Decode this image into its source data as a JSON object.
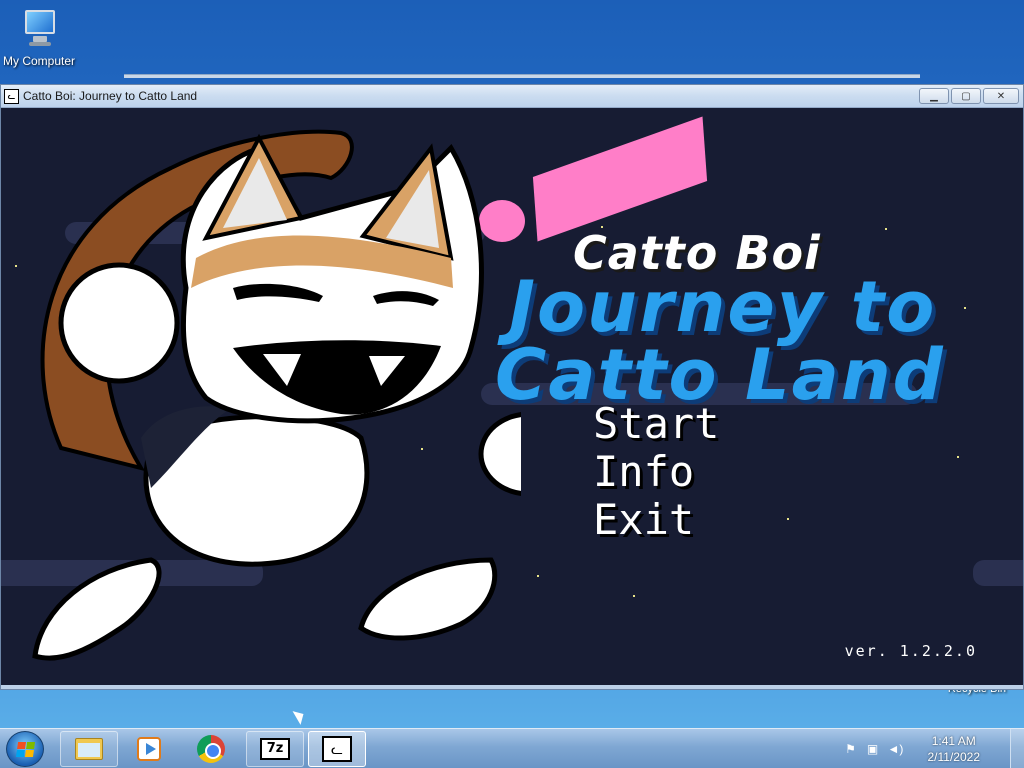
{
  "desktop": {
    "icons": [
      {
        "label": "My Computer",
        "icon": "my-computer-icon"
      }
    ],
    "recycle_bin_label": "Recycle Bin"
  },
  "window": {
    "title": "Catto Boi: Journey to Catto Land",
    "icon": "catto-app-icon",
    "controls": {
      "minimize": "▁",
      "maximize": "▢",
      "close": "✕"
    }
  },
  "game": {
    "logo": {
      "line1": "Catto Boi",
      "line2": "Journey to",
      "line3": "Catto Land"
    },
    "menu": [
      {
        "label": "Start"
      },
      {
        "label": "Info"
      },
      {
        "label": "Exit"
      }
    ],
    "version": "ver. 1.2.2.0",
    "colors": {
      "background": "#171c33",
      "logo_blue": "#2aa0ee",
      "accent_pink": "#ff7ec8",
      "cat_brown": "#8b4d22",
      "cat_orange": "#d9a266"
    }
  },
  "taskbar": {
    "items": [
      {
        "name": "windows-explorer",
        "icon": "folder-icon"
      },
      {
        "name": "windows-media-player",
        "icon": "media-player-icon"
      },
      {
        "name": "google-chrome",
        "icon": "chrome-icon"
      },
      {
        "name": "7-zip",
        "icon": "7zip-icon",
        "label": "7z"
      },
      {
        "name": "catto-boi",
        "icon": "catto-app-icon"
      }
    ],
    "tray": {
      "time": "1:41 AM",
      "date": "2/11/2022"
    }
  }
}
